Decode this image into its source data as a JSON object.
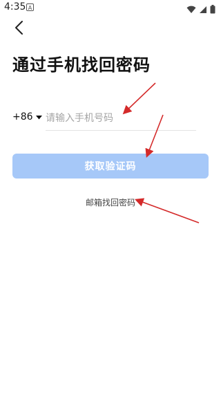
{
  "status_bar": {
    "time": "4:35",
    "app_icon_letter": "A",
    "icons": [
      "wifi-icon",
      "signal-icon",
      "battery-icon"
    ]
  },
  "nav": {
    "back_icon": "back-arrow-icon"
  },
  "title": "通过手机找回密码",
  "phone": {
    "country_code": "+86",
    "dropdown_icon": "caret-down-icon",
    "placeholder": "请输入手机号码",
    "value": ""
  },
  "get_code_button": {
    "label": "获取验证码",
    "color": "#a6c8f8"
  },
  "email_recover": {
    "label": "邮箱找回密码"
  },
  "annotations": {
    "arrow_color": "#d42a2a"
  }
}
